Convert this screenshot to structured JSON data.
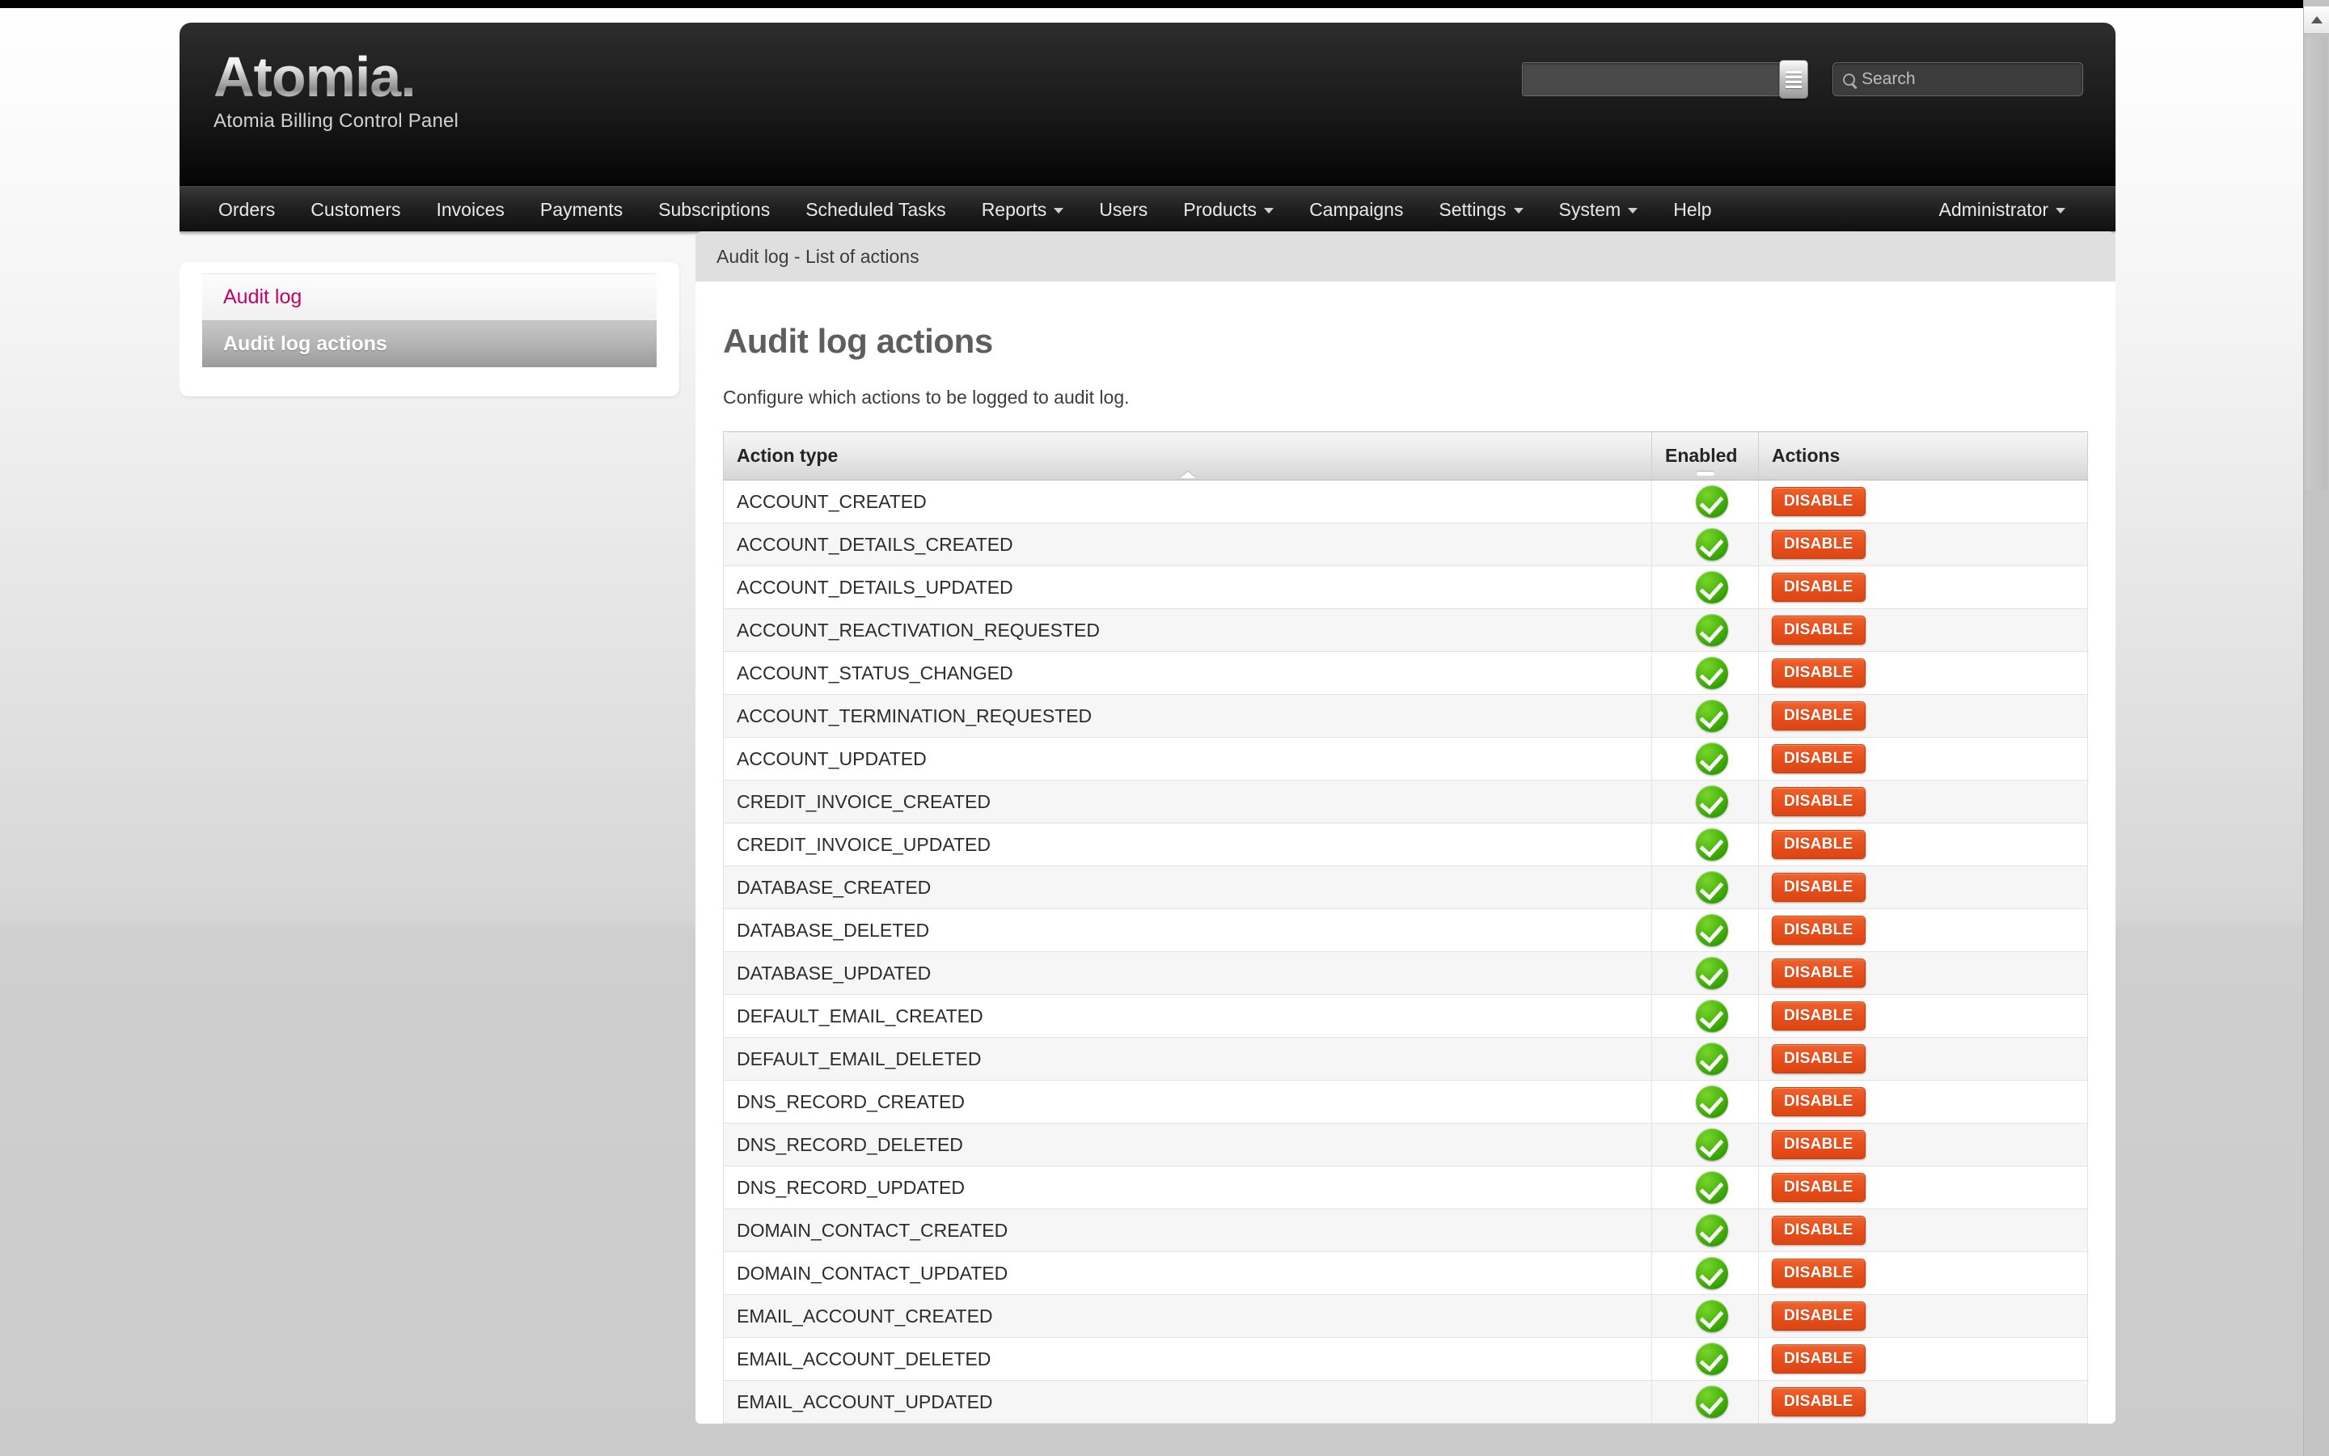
{
  "brand": {
    "logo_text": "Atomia.",
    "tagline": "Atomia Billing Control Panel"
  },
  "header": {
    "combo_value": "",
    "combo_placeholder": "",
    "combo_button_icon": "list-menu-icon",
    "search_icon": "search-icon",
    "search_placeholder": "Search",
    "search_value": ""
  },
  "nav": {
    "left_items": [
      {
        "label": "Orders",
        "has_caret": false
      },
      {
        "label": "Customers",
        "has_caret": false
      },
      {
        "label": "Invoices",
        "has_caret": false
      },
      {
        "label": "Payments",
        "has_caret": false
      },
      {
        "label": "Subscriptions",
        "has_caret": false
      },
      {
        "label": "Scheduled Tasks",
        "has_caret": false
      },
      {
        "label": "Reports",
        "has_caret": true
      },
      {
        "label": "Users",
        "has_caret": false
      },
      {
        "label": "Products",
        "has_caret": true
      },
      {
        "label": "Campaigns",
        "has_caret": false
      },
      {
        "label": "Settings",
        "has_caret": true
      },
      {
        "label": "System",
        "has_caret": true
      },
      {
        "label": "Help",
        "has_caret": false
      }
    ],
    "right_items": [
      {
        "label": "Administrator",
        "has_caret": true
      }
    ]
  },
  "sidebar": {
    "items": [
      {
        "label": "Audit log",
        "active": false
      },
      {
        "label": "Audit log actions",
        "active": true
      }
    ]
  },
  "main": {
    "breadcrumb": "Audit log - List of actions",
    "title": "Audit log actions",
    "description": "Configure which actions to be logged to audit log.",
    "table": {
      "columns": [
        {
          "label": "Action type",
          "sort": "asc"
        },
        {
          "label": "Enabled",
          "sort": "none"
        },
        {
          "label": "Actions",
          "sort": null
        }
      ],
      "enabled_icon": "green-check-icon",
      "action_button_label": "DISABLE",
      "rows": [
        {
          "action_type": "ACCOUNT_CREATED",
          "enabled": true
        },
        {
          "action_type": "ACCOUNT_DETAILS_CREATED",
          "enabled": true
        },
        {
          "action_type": "ACCOUNT_DETAILS_UPDATED",
          "enabled": true
        },
        {
          "action_type": "ACCOUNT_REACTIVATION_REQUESTED",
          "enabled": true
        },
        {
          "action_type": "ACCOUNT_STATUS_CHANGED",
          "enabled": true
        },
        {
          "action_type": "ACCOUNT_TERMINATION_REQUESTED",
          "enabled": true
        },
        {
          "action_type": "ACCOUNT_UPDATED",
          "enabled": true
        },
        {
          "action_type": "CREDIT_INVOICE_CREATED",
          "enabled": true
        },
        {
          "action_type": "CREDIT_INVOICE_UPDATED",
          "enabled": true
        },
        {
          "action_type": "DATABASE_CREATED",
          "enabled": true
        },
        {
          "action_type": "DATABASE_DELETED",
          "enabled": true
        },
        {
          "action_type": "DATABASE_UPDATED",
          "enabled": true
        },
        {
          "action_type": "DEFAULT_EMAIL_CREATED",
          "enabled": true
        },
        {
          "action_type": "DEFAULT_EMAIL_DELETED",
          "enabled": true
        },
        {
          "action_type": "DNS_RECORD_CREATED",
          "enabled": true
        },
        {
          "action_type": "DNS_RECORD_DELETED",
          "enabled": true
        },
        {
          "action_type": "DNS_RECORD_UPDATED",
          "enabled": true
        },
        {
          "action_type": "DOMAIN_CONTACT_CREATED",
          "enabled": true
        },
        {
          "action_type": "DOMAIN_CONTACT_UPDATED",
          "enabled": true
        },
        {
          "action_type": "EMAIL_ACCOUNT_CREATED",
          "enabled": true
        },
        {
          "action_type": "EMAIL_ACCOUNT_DELETED",
          "enabled": true
        },
        {
          "action_type": "EMAIL_ACCOUNT_UPDATED",
          "enabled": true
        }
      ]
    }
  },
  "scrollbar": {
    "up_arrow_icon": "chevron-up-icon"
  },
  "colors": {
    "link_pink": "#c4006b",
    "disable_orange": "#e8521f",
    "enabled_green": "#4cb80d"
  }
}
